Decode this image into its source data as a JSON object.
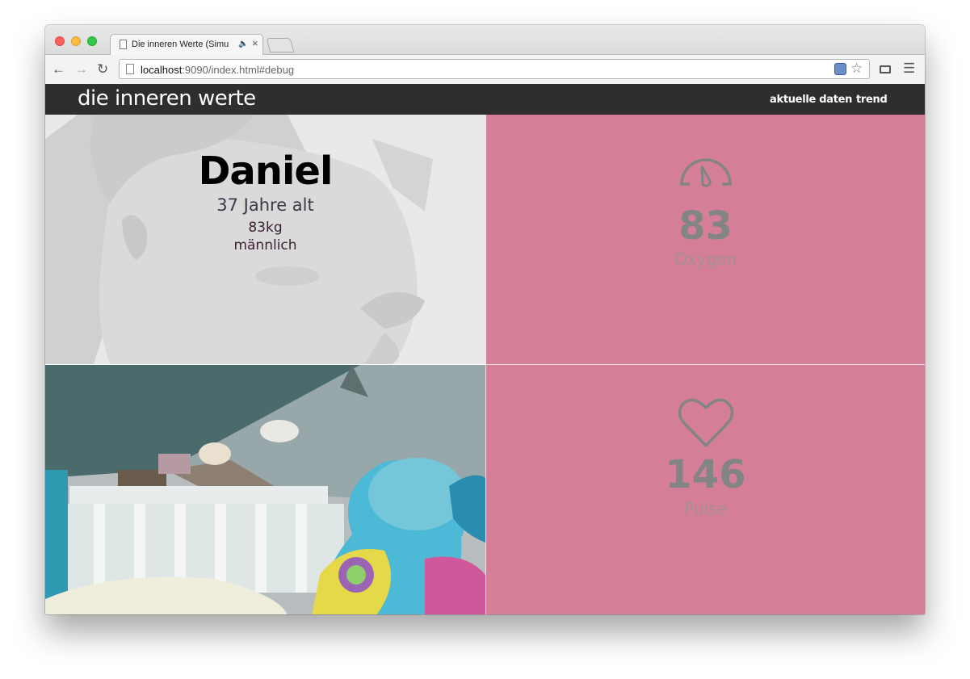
{
  "browser": {
    "tab_title": "Die inneren Werte (Simu",
    "url_host": "localhost",
    "url_rest": ":9090/index.html#debug"
  },
  "app": {
    "brand": "die inneren werte",
    "nav": [
      "aktuelle daten",
      "trend"
    ]
  },
  "profile": {
    "name": "Daniel",
    "age": "37 Jahre alt",
    "weight": "83kg",
    "gender": "männlich"
  },
  "metrics": {
    "oxygen": {
      "value": "83",
      "label": "Oxygen",
      "icon": "gauge-icon"
    },
    "pulse": {
      "value": "146",
      "label": "Pulse",
      "icon": "heart-icon"
    }
  },
  "colors": {
    "navbar": "#2e2e2e",
    "tile_pink": "#d57e97",
    "metric_value": "#838585",
    "metric_label": "#a38f96"
  }
}
